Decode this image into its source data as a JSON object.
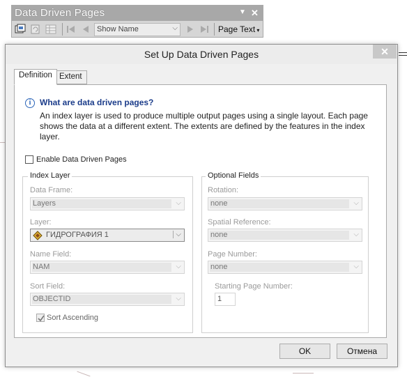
{
  "toolbar": {
    "title": "Data Driven Pages",
    "pin_icon": "dropdown-arrow-icon",
    "close_glyph": "✕",
    "show_name": "Show Name",
    "page_text": "Page Text"
  },
  "dialog": {
    "title": "Set Up Data Driven Pages",
    "close_glyph": "✕",
    "tabs": [
      {
        "label": "Definition",
        "active": true
      },
      {
        "label": "Extent",
        "active": false
      }
    ],
    "info": {
      "heading": "What are data driven pages?",
      "body": "An index layer is used to produce multiple output pages using a single layout.  Each page shows the data at a different extent.  The extents are defined by the features in the index layer."
    },
    "enable_label": "Enable Data Driven Pages",
    "enable_checked": false,
    "index_layer": {
      "title": "Index Layer",
      "data_frame_label": "Data Frame:",
      "data_frame_value": "Layers",
      "layer_label": "Layer:",
      "layer_value": "ГИДРОГРАФИЯ 1",
      "name_field_label": "Name Field:",
      "name_field_value": "NAM",
      "sort_field_label": "Sort Field:",
      "sort_field_value": "OBJECTID",
      "sort_ascending_label": "Sort Ascending",
      "sort_ascending_checked": true
    },
    "optional_fields": {
      "title": "Optional Fields",
      "rotation_label": "Rotation:",
      "rotation_value": "none",
      "spatial_ref_label": "Spatial Reference:",
      "spatial_ref_value": "none",
      "page_number_label": "Page Number:",
      "page_number_value": "none",
      "starting_page_label": "Starting Page Number:",
      "starting_page_value": "1"
    },
    "buttons": {
      "ok": "OK",
      "cancel": "Отмена"
    }
  }
}
